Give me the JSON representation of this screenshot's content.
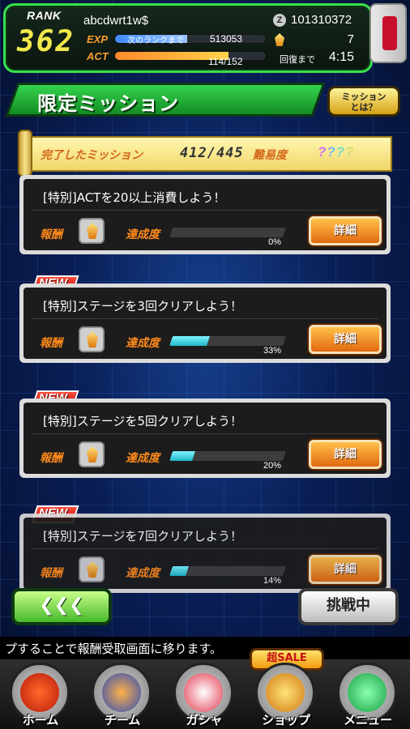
{
  "status": {
    "rank_label": "RANK",
    "rank_value": "362",
    "user_name": "abcdwrt1w$",
    "exp_label": "EXP",
    "exp_note": "次のランクまで",
    "exp_value": "513053",
    "act_label": "ACT",
    "act_value": "114/152",
    "zeni_value": "101310372",
    "stone_value": "7",
    "recover_label": "回復まで",
    "recover_time": "4:15"
  },
  "header": {
    "title": "限定ミッション",
    "about_button": "ミッション\nとは？"
  },
  "summary": {
    "completed_label": "完了したミッション",
    "completed_value": "412/445",
    "difficulty_label": "難易度",
    "difficulty_value": "????"
  },
  "missions": [
    {
      "new": false,
      "title": "[特別]ACTを20以上消費しよう！",
      "reward_label": "報酬",
      "progress_label": "達成度",
      "progress": "0%",
      "progress_fraction": 0.0,
      "detail_label": "詳細"
    },
    {
      "new": true,
      "new_label": "NEW",
      "title": "[特別]ステージを3回クリアしよう！",
      "reward_label": "報酬",
      "progress_label": "達成度",
      "progress": "33%",
      "progress_fraction": 0.33,
      "detail_label": "詳細"
    },
    {
      "new": true,
      "new_label": "NEW",
      "title": "[特別]ステージを5回クリアしよう！",
      "reward_label": "報酬",
      "progress_label": "達成度",
      "progress": "20%",
      "progress_fraction": 0.2,
      "detail_label": "詳細"
    },
    {
      "new": true,
      "new_label": "NEW",
      "title": "[特別]ステージを7回クリアしよう！",
      "reward_label": "報酬",
      "progress_label": "達成度",
      "progress": "14%",
      "progress_fraction": 0.14,
      "detail_label": "詳細"
    }
  ],
  "buttons": {
    "back": "❮❮❮",
    "challenge": "挑戦中"
  },
  "ticker": "プすることで報酬受取画面に移ります。",
  "sale_badge": "超SALE",
  "nav": [
    {
      "label": "ホーム",
      "icon": "home-icon"
    },
    {
      "label": "チーム",
      "icon": "team-icon"
    },
    {
      "label": "ガシャ",
      "icon": "gacha-icon"
    },
    {
      "label": "ショップ",
      "icon": "shop-icon"
    },
    {
      "label": "メニュー",
      "icon": "menu-icon"
    }
  ],
  "colors": {
    "accent_green": "#3be04e",
    "progress_cyan": "#1eb8c8",
    "label_orange": "#ff8a1a",
    "new_red": "#c8102e"
  }
}
